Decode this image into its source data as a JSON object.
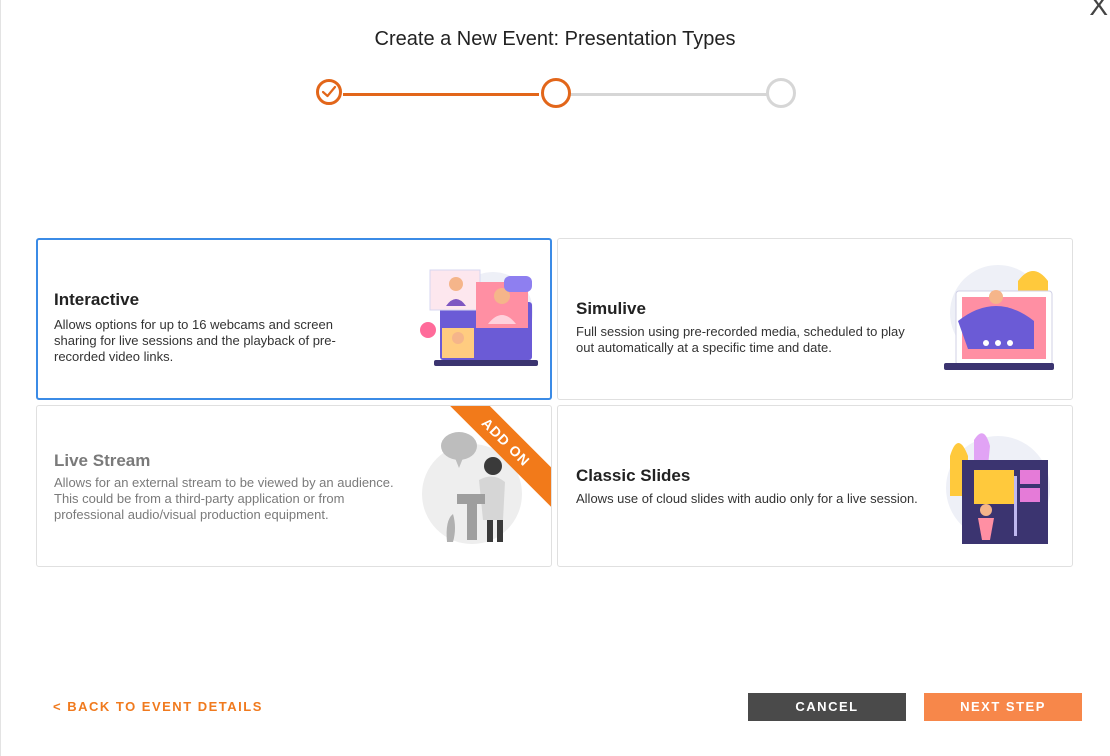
{
  "dialog": {
    "title": "Create a New Event: Presentation Types",
    "close_label": "X"
  },
  "stepper": {
    "steps": [
      {
        "state": "complete"
      },
      {
        "state": "current"
      },
      {
        "state": "upcoming"
      }
    ],
    "accent_color": "#e2661a"
  },
  "cards": [
    {
      "title": "Interactive",
      "description": "Allows options for up to 16 webcams and screen sharing for live sessions and the playback of pre-recorded video links.",
      "selected": true,
      "illustration": "webcam-meeting-illustration"
    },
    {
      "title": "Simulive",
      "description": "Full session using pre-recorded media, scheduled to play out automatically at a specific time and date.",
      "selected": false,
      "illustration": "presenter-laptop-illustration"
    },
    {
      "title": "Live Stream",
      "description": "Allows for an external stream to be viewed by an audience. This could be from a third-party application or from professional audio/visual production equipment.",
      "selected": false,
      "disabled": true,
      "badge": "ADD ON",
      "illustration": "speaker-podium-illustration"
    },
    {
      "title": "Classic Slides",
      "description": "Allows use of cloud slides with audio only for a live session.",
      "selected": false,
      "illustration": "slides-board-illustration"
    }
  ],
  "footer": {
    "back_label": "< BACK TO EVENT DETAILS",
    "cancel_label": "CANCEL",
    "next_label": "NEXT STEP"
  },
  "colors": {
    "selected_border": "#3b8be6",
    "orange": "#f07a1e",
    "cancel_bg": "#4a4a4a",
    "next_bg": "#f7874a"
  }
}
